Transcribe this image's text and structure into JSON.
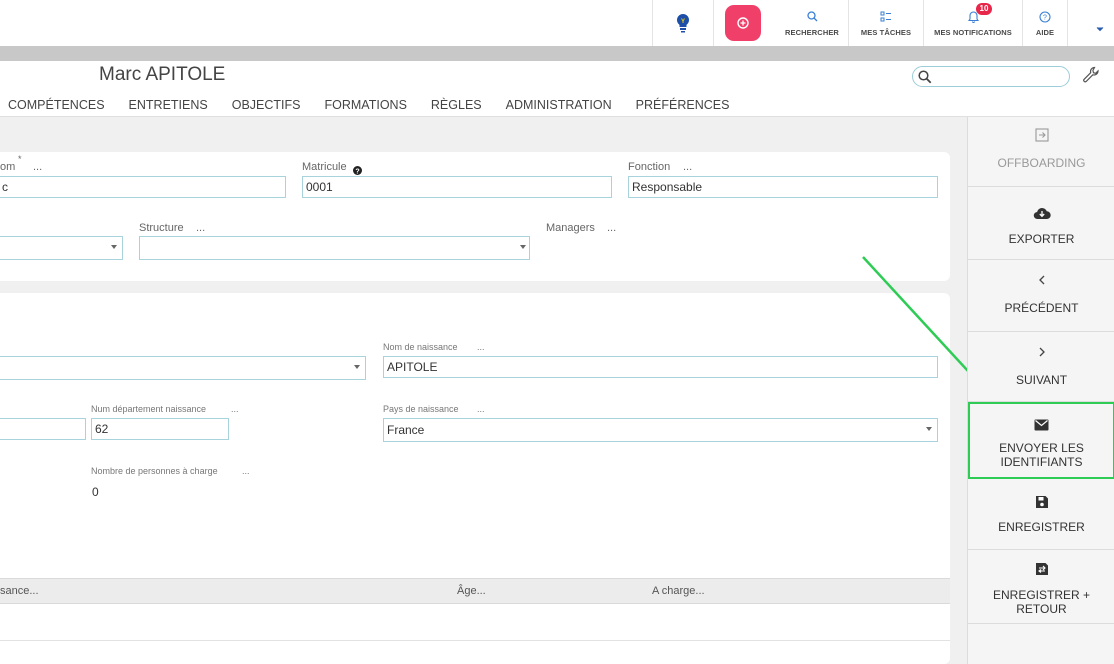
{
  "topbar": {
    "search_label": "RECHERCHER",
    "tasks_label": "MES TÂCHES",
    "notifications_label": "MES NOTIFICATIONS",
    "notifications_count": "10",
    "help_label": "AIDE"
  },
  "header": {
    "employee_name": "Marc APITOLE",
    "search_placeholder": "",
    "tabs": [
      "COMPÉTENCES",
      "ENTRETIENS",
      "OBJECTIFS",
      "FORMATIONS",
      "RÈGLES",
      "ADMINISTRATION",
      "PRÉFÉRENCES"
    ]
  },
  "identity": {
    "nom_label": "om",
    "nom_required_mark": "*",
    "nom_dots": "...",
    "nom_value": "c",
    "matricule_label": "Matricule",
    "matricule_value": "0001",
    "fonction_label": "Fonction",
    "fonction_dots": "...",
    "fonction_value": "Responsable",
    "structure_label": "Structure",
    "structure_dots": "...",
    "structure_value": "",
    "managers_label": "Managers",
    "managers_dots": "..."
  },
  "birth": {
    "nom_naissance_label": "Nom de naissance",
    "nom_naissance_dots": "...",
    "nom_naissance_value": "APITOLE",
    "num_dept_label": "Num département naissance",
    "num_dept_dots": "...",
    "num_dept_value": "62",
    "pays_label": "Pays de naissance",
    "pays_dots": "...",
    "pays_value": "France",
    "personnes_charge_label": "Nombre de personnes à charge",
    "personnes_charge_dots": "...",
    "personnes_charge_value": "0"
  },
  "children_table": {
    "headers": [
      "sance...",
      "Âge...",
      "A charge..."
    ]
  },
  "actions": {
    "offboarding": "OFFBOARDING",
    "exporter": "EXPORTER",
    "precedent": "PRÉCÉDENT",
    "suivant": "SUIVANT",
    "envoyer_line1": "ENVOYER LES",
    "envoyer_line2": "IDENTIFIANTS",
    "enregistrer": "ENREGISTRER",
    "enregistrer_retour_line1": "ENREGISTRER +",
    "enregistrer_retour_line2": "RETOUR"
  },
  "colors": {
    "accent_pink": "#f0406a",
    "highlight_green": "#2ecc55",
    "input_border": "#a8d2dc",
    "badge_red": "#e8264a",
    "bulb_blue": "#1d4fa8"
  }
}
